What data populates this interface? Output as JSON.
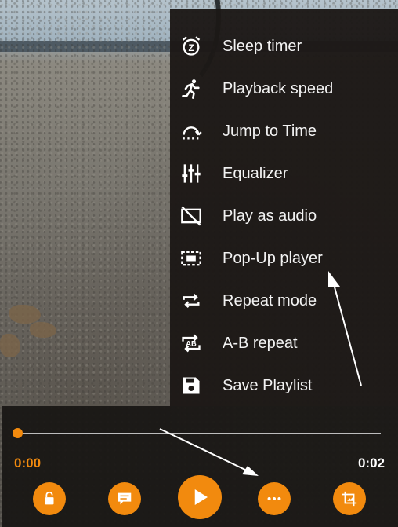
{
  "menu": {
    "items": [
      {
        "label": "Sleep timer",
        "icon": "alarm-clock-icon"
      },
      {
        "label": "Playback speed",
        "icon": "running-man-icon"
      },
      {
        "label": "Jump to Time",
        "icon": "jump-arc-icon"
      },
      {
        "label": "Equalizer",
        "icon": "equalizer-sliders-icon"
      },
      {
        "label": "Play as audio",
        "icon": "video-off-icon"
      },
      {
        "label": "Pop-Up player",
        "icon": "picture-in-picture-icon"
      },
      {
        "label": "Repeat mode",
        "icon": "repeat-icon"
      },
      {
        "label": "A-B repeat",
        "icon": "ab-repeat-icon"
      },
      {
        "label": "Save Playlist",
        "icon": "save-disk-icon"
      }
    ]
  },
  "player": {
    "current_time": "0:00",
    "total_time": "0:02",
    "progress": 0.0,
    "accent_color": "#f28a0e",
    "buttons": [
      "lock-icon",
      "subtitles-icon",
      "play-icon",
      "more-options-icon",
      "crop-icon"
    ]
  }
}
